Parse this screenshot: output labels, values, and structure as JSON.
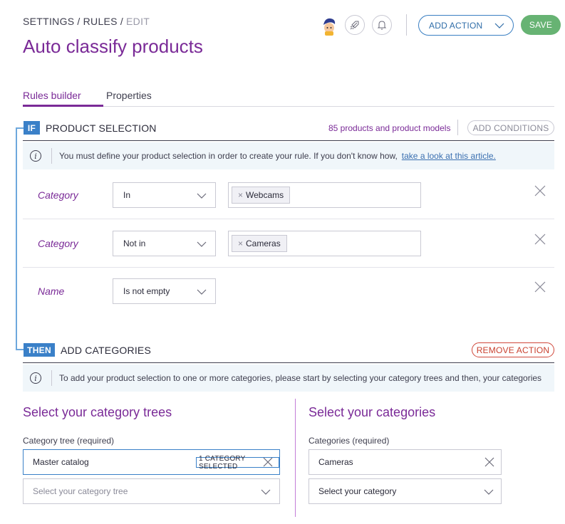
{
  "header": {
    "breadcrumb": [
      "SETTINGS",
      "RULES",
      "EDIT"
    ],
    "separator": "/",
    "title": "Auto classify products",
    "add_action_label": "ADD ACTION",
    "save_label": "SAVE"
  },
  "tabs": [
    {
      "label": "Rules builder",
      "active": true
    },
    {
      "label": "Properties",
      "active": false
    }
  ],
  "if_section": {
    "badge": "IF",
    "title": "PRODUCT SELECTION",
    "count": "85 products and product models",
    "add_conditions_label": "ADD CONDITIONS",
    "info_text": "You must define your product selection in order to create your rule. If you don't know how,",
    "info_link": "take a look at this article.",
    "conditions": [
      {
        "field": "Category",
        "operator": "In",
        "value": "Webcams"
      },
      {
        "field": "Category",
        "operator": "Not in",
        "value": "Cameras"
      },
      {
        "field": "Name",
        "operator": "Is not empty",
        "value": ""
      }
    ]
  },
  "then_section": {
    "badge": "THEN",
    "title": "ADD CATEGORIES",
    "remove_action_label": "REMOVE ACTION",
    "info_text": "To add your product selection to one or more categories, please start by selecting your category trees and then, your categories"
  },
  "category_trees": {
    "title": "Select your category trees",
    "label": "Category tree (required)",
    "selected_value": "Master catalog",
    "selected_badge": "1 CATEGORY SELECTED",
    "placeholder": "Select your category tree"
  },
  "categories": {
    "title": "Select your categories",
    "label": "Categories (required)",
    "selected_value": "Cameras",
    "placeholder": "Select your category"
  },
  "colors": {
    "primary_purple": "#7a2a97",
    "accent_blue": "#3a80c8",
    "save_green": "#67b373",
    "danger_red": "#c9412f"
  },
  "icons": [
    "avatar",
    "rocket-icon",
    "bell-icon",
    "chevron-down-icon",
    "info-icon",
    "close-icon"
  ]
}
